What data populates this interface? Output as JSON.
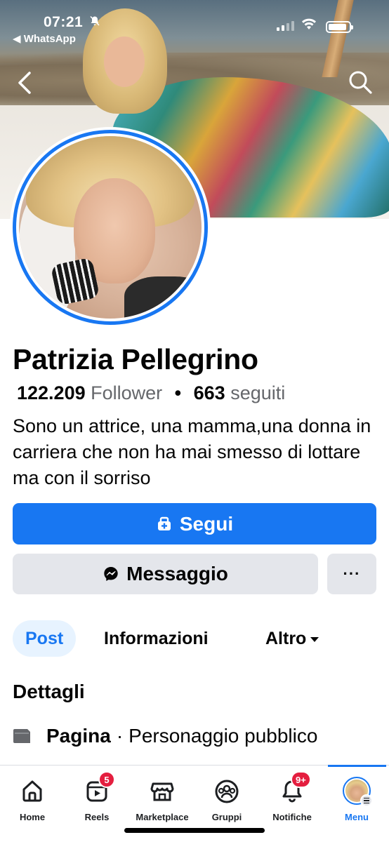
{
  "status_bar": {
    "time": "07:21",
    "back_app": "◀ WhatsApp",
    "battery_level": 0.9
  },
  "profile": {
    "name": "Patrizia Pellegrino",
    "followers_count": "122.209",
    "followers_label": "Follower",
    "separator": "•",
    "following_count": "663",
    "following_label": "seguiti",
    "bio": "Sono un attrice, una mamma,una donna in carriera che non ha mai smesso di lottare ma con il sorriso"
  },
  "actions": {
    "follow_label": "Segui",
    "message_label": "Messaggio",
    "more_label": "···"
  },
  "tabs": [
    {
      "label": "Post",
      "active": true
    },
    {
      "label": "Informazioni",
      "active": false
    },
    {
      "label": "Altro",
      "active": false
    }
  ],
  "details": {
    "title": "Dettagli",
    "type_label": "Pagina",
    "type_separator": "·",
    "type_value": "Personaggio pubblico"
  },
  "bottom_nav": [
    {
      "label": "Home",
      "icon": "home-icon"
    },
    {
      "label": "Reels",
      "icon": "reels-icon",
      "badge": "5"
    },
    {
      "label": "Marketplace",
      "icon": "marketplace-icon"
    },
    {
      "label": "Gruppi",
      "icon": "groups-icon"
    },
    {
      "label": "Notifiche",
      "icon": "bell-icon",
      "badge": "9+"
    },
    {
      "label": "Menu",
      "icon": "menu-avatar",
      "active": true
    }
  ],
  "colors": {
    "accent": "#1877f2",
    "badge": "#e41e3f",
    "secondary_button": "#e4e6eb",
    "muted_text": "#65676b",
    "active_tab_bg": "#e7f3ff"
  }
}
